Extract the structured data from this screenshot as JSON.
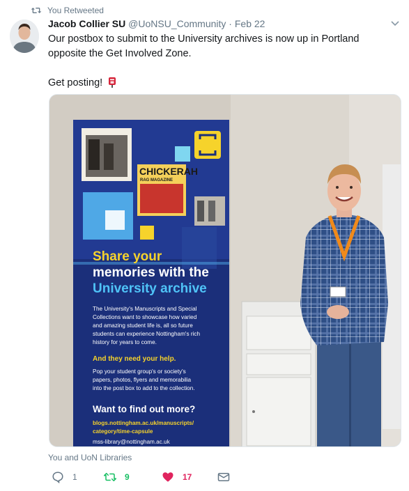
{
  "retweet_bar": {
    "label": "You Retweeted",
    "icon": "retweet-icon"
  },
  "tweet": {
    "author_name": "Jacob Collier SU",
    "handle": "@UoNSU_Community",
    "separator": "·",
    "date": "Feb 22",
    "text_line1": "Our postbox to submit to the University archives is now up in Portland opposite the Get Involved Zone.",
    "text_line2": "Get posting!",
    "emoji_icon": "postbox-icon"
  },
  "poster": {
    "magazine_title": "CHICKERAH",
    "magazine_subtitle": "RAG MAGAZINE",
    "heading_line1": "Share your",
    "heading_line2": "memories with the",
    "heading_line3": "University archive",
    "body1_l1": "The University's Manuscripts and Special",
    "body1_l2": "Collections want to showcase how varied",
    "body1_l3": "and amazing student life is, all so future",
    "body1_l4": "students can experience Nottingham's rich",
    "body1_l5": "history for years to come.",
    "help": "And they need your help.",
    "body2_l1": "Pop your student group's or society's",
    "body2_l2": "papers, photos, flyers and memorabilia",
    "body2_l3": "into the post box to add to the collection.",
    "find_out": "Want to find out more?",
    "url_l1": "blogs.nottingham.ac.uk/manuscripts/",
    "url_l2": "category/time-capsule",
    "email": "mss-library@nottingham.ac.uk"
  },
  "liked_by": "You and UoN Libraries",
  "actions": {
    "reply_count": "1",
    "retweet_count": "9",
    "like_count": "17"
  },
  "colors": {
    "retweet_green": "#17bf63",
    "like_red": "#e0245e",
    "muted": "#657786",
    "poster_navy": "#1b2f7a",
    "poster_yellow": "#f6d32b"
  }
}
